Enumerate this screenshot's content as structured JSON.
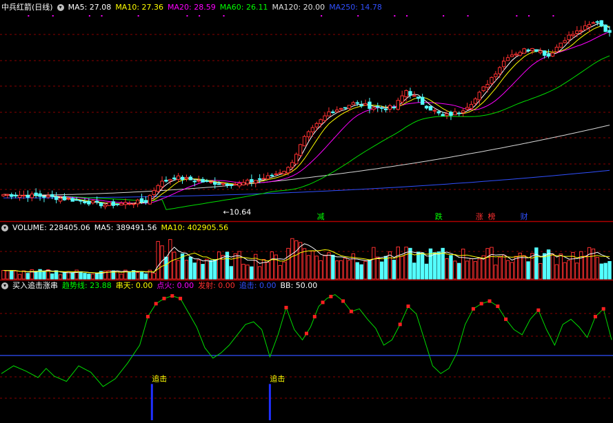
{
  "stock": {
    "name": "中兵红箭(日线)"
  },
  "price_header": [
    {
      "label": "MA5: 27.08",
      "color": "#ffffff"
    },
    {
      "label": "MA10: 27.36",
      "color": "#ffff00"
    },
    {
      "label": "MA20: 28.59",
      "color": "#ff00ff"
    },
    {
      "label": "MA60: 26.11",
      "color": "#00ff00"
    },
    {
      "label": "MA120: 20.00",
      "color": "#e0e0e0"
    },
    {
      "label": "MA250: 14.78",
      "color": "#3050ff"
    }
  ],
  "volume_header": [
    {
      "label": "VOLUME: 228405.06",
      "color": "#ffffff"
    },
    {
      "label": "MA5: 389491.56",
      "color": "#ffffff"
    },
    {
      "label": "MA10: 402905.56",
      "color": "#ffff00"
    }
  ],
  "indicator_header": [
    {
      "label": "买入追击涨串",
      "color": "#ffffff"
    },
    {
      "label": "趋势线: 23.88",
      "color": "#00ff00"
    },
    {
      "label": "串天: 0.00",
      "color": "#ffff00"
    },
    {
      "label": "点火: 0.00",
      "color": "#ff00ff"
    },
    {
      "label": "发射: 0.00",
      "color": "#ff3030"
    },
    {
      "label": "追击: 0.00",
      "color": "#3050ff"
    },
    {
      "label": "BB: 50.00",
      "color": "#ffffff"
    }
  ],
  "chart_data": [
    {
      "type": "candlestick",
      "title": "中兵红箭(日线)",
      "low_label": "10.64",
      "ylim": [
        9,
        33
      ],
      "bar_count": 150,
      "close_path": [
        [
          0,
          12.0
        ],
        [
          10,
          11.8
        ],
        [
          20,
          11.2
        ],
        [
          25,
          10.8
        ],
        [
          30,
          11.0
        ],
        [
          35,
          11.2
        ],
        [
          38,
          13.2
        ],
        [
          42,
          14.0
        ],
        [
          50,
          13.4
        ],
        [
          58,
          13.2
        ],
        [
          65,
          14.0
        ],
        [
          70,
          15.0
        ],
        [
          74,
          18.5
        ],
        [
          80,
          21.5
        ],
        [
          86,
          22.5
        ],
        [
          92,
          22.0
        ],
        [
          96,
          22.0
        ],
        [
          99,
          24.0
        ],
        [
          103,
          22.5
        ],
        [
          108,
          21.0
        ],
        [
          112,
          21.5
        ],
        [
          116,
          23.0
        ],
        [
          120,
          25.5
        ],
        [
          124,
          28.0
        ],
        [
          130,
          29.0
        ],
        [
          134,
          28.0
        ],
        [
          138,
          30.0
        ],
        [
          142,
          31.0
        ],
        [
          146,
          32.0
        ],
        [
          149,
          30.5
        ]
      ],
      "ma5": 27.08,
      "ma10": 27.36,
      "ma20": 28.59,
      "ma60": 26.11,
      "ma120": 20.0,
      "ma250": 14.78,
      "signals": [
        {
          "label": "减",
          "bar": 78,
          "color": "#00ff00"
        },
        {
          "label": "跌",
          "bar": 107,
          "color": "#00ff00"
        },
        {
          "label": "涨",
          "bar": 117,
          "color": "#ff3030"
        },
        {
          "label": "榜",
          "bar": 120,
          "color": "#ff3030"
        },
        {
          "label": "财",
          "bar": 128,
          "color": "#3050ff"
        }
      ]
    },
    {
      "type": "bar",
      "title": "VOLUME",
      "volume": 228405.06,
      "ma5": 389491.56,
      "ma10": 402905.56,
      "ylim": [
        0,
        600000
      ]
    },
    {
      "type": "line",
      "title": "买入追击涨串",
      "ylim": [
        0,
        100
      ],
      "reference_line": 50,
      "trend_path": [
        [
          0,
          36
        ],
        [
          3,
          42
        ],
        [
          6,
          38
        ],
        [
          9,
          33
        ],
        [
          11,
          40
        ],
        [
          13,
          34
        ],
        [
          16,
          30
        ],
        [
          19,
          42
        ],
        [
          22,
          37
        ],
        [
          25,
          26
        ],
        [
          28,
          32
        ],
        [
          31,
          44
        ],
        [
          34,
          58
        ],
        [
          36,
          80
        ],
        [
          38,
          90
        ],
        [
          40,
          94
        ],
        [
          42,
          96
        ],
        [
          44,
          94
        ],
        [
          46,
          83
        ],
        [
          48,
          72
        ],
        [
          50,
          56
        ],
        [
          52,
          48
        ],
        [
          54,
          52
        ],
        [
          56,
          58
        ],
        [
          58,
          66
        ],
        [
          60,
          74
        ],
        [
          62,
          76
        ],
        [
          64,
          70
        ],
        [
          66,
          49
        ],
        [
          68,
          66
        ],
        [
          70,
          87
        ],
        [
          72,
          70
        ],
        [
          74,
          62
        ],
        [
          76,
          72
        ],
        [
          78,
          88
        ],
        [
          80,
          94
        ],
        [
          82,
          97
        ],
        [
          84,
          92
        ],
        [
          86,
          84
        ],
        [
          88,
          86
        ],
        [
          90,
          78
        ],
        [
          92,
          71
        ],
        [
          94,
          58
        ],
        [
          96,
          62
        ],
        [
          98,
          74
        ],
        [
          100,
          88
        ],
        [
          102,
          82
        ],
        [
          104,
          62
        ],
        [
          106,
          42
        ],
        [
          108,
          36
        ],
        [
          110,
          40
        ],
        [
          112,
          52
        ],
        [
          114,
          74
        ],
        [
          116,
          86
        ],
        [
          118,
          90
        ],
        [
          120,
          92
        ],
        [
          122,
          88
        ],
        [
          124,
          78
        ],
        [
          126,
          70
        ],
        [
          128,
          66
        ],
        [
          130,
          78
        ],
        [
          132,
          85
        ],
        [
          134,
          70
        ],
        [
          136,
          58
        ],
        [
          138,
          74
        ],
        [
          140,
          78
        ],
        [
          142,
          72
        ],
        [
          144,
          64
        ],
        [
          146,
          80
        ],
        [
          148,
          86
        ],
        [
          150,
          62
        ]
      ],
      "red_dot_ranges": [
        [
          36,
          44
        ],
        [
          70,
          70
        ],
        [
          75,
          82
        ],
        [
          84,
          86
        ],
        [
          98,
          101
        ],
        [
          116,
          124
        ],
        [
          132,
          132
        ],
        [
          146,
          148
        ]
      ],
      "buy_signals": [
        {
          "label": "追击",
          "bar": 37
        },
        {
          "label": "追击",
          "bar": 66
        }
      ]
    }
  ]
}
